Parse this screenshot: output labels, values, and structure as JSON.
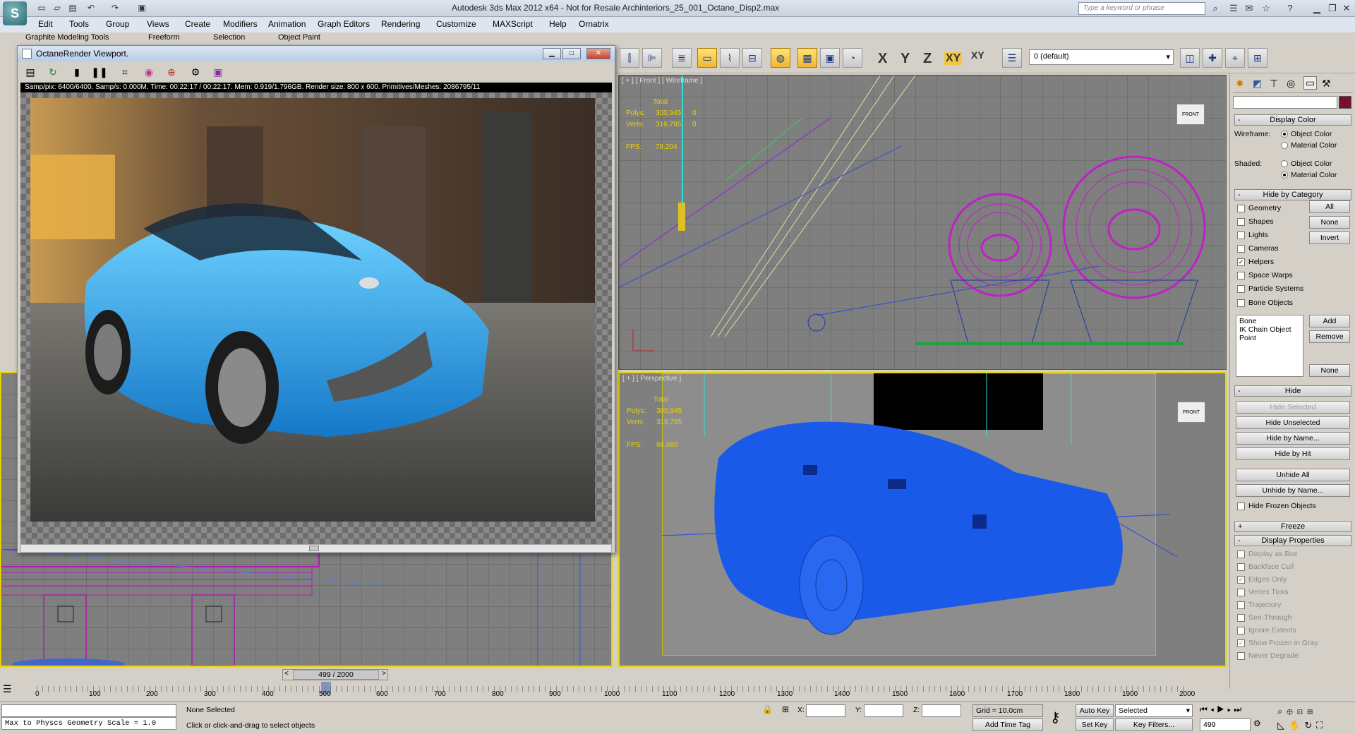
{
  "app": {
    "title": "Autodesk 3ds Max  2012 x64   - Not for Resale   Archinteriors_25_001_Octane_Disp2.max",
    "search_placeholder": "Type a keyword or phrase"
  },
  "menubar": [
    "Edit",
    "Tools",
    "Group",
    "Views",
    "Create",
    "Modifiers",
    "Animation",
    "Graph Editors",
    "Rendering",
    "Customize",
    "MAXScript",
    "Help",
    "Ornatrix"
  ],
  "ribbon_tabs": [
    "Graphite Modeling Tools",
    "Freeform",
    "Selection",
    "Object Paint"
  ],
  "toolbar": {
    "axes": [
      "X",
      "Y",
      "Z",
      "XY",
      "XY"
    ],
    "layer_value": "0 (default)"
  },
  "octane": {
    "title": "OctaneRender Viewport.",
    "stats": "Samp/pix: 6400/6400.  Samp/s: 0.000M.  Time: 00:22:17 / 00:22:17.  Mem: 0.919/1.796GB.  Render size: 800 x 600.  Primitives/Meshes: 2086795/11"
  },
  "viewports": {
    "front": {
      "label": "[ + ] [ Front ] [ Wireframe ]",
      "total": "Total",
      "polys_label": "Polys:",
      "polys": "300,945",
      "polys_sel": "0",
      "verts_label": "Verts:",
      "verts": "316,795",
      "verts_sel": "0",
      "fps_label": "FPS:",
      "fps": "78.204",
      "viewcube": "FRONT"
    },
    "persp": {
      "label": "[ + ] [ Perspective ]",
      "total": "Total",
      "polys_label": "Polys:",
      "polys": "300,945",
      "verts_label": "Verts:",
      "verts": "316,795",
      "fps_label": "FPS:",
      "fps": "66.660",
      "viewcube": "FRONT"
    }
  },
  "command_panel": {
    "display_color": {
      "header": "Display Color",
      "wireframe_label": "Wireframe:",
      "shaded_label": "Shaded:",
      "object_color": "Object Color",
      "material_color": "Material Color"
    },
    "hide_by_category": {
      "header": "Hide by Category",
      "items": [
        {
          "label": "Geometry",
          "checked": false
        },
        {
          "label": "Shapes",
          "checked": false
        },
        {
          "label": "Lights",
          "checked": false
        },
        {
          "label": "Cameras",
          "checked": false
        },
        {
          "label": "Helpers",
          "checked": true
        },
        {
          "label": "Space Warps",
          "checked": false
        },
        {
          "label": "Particle Systems",
          "checked": false
        },
        {
          "label": "Bone Objects",
          "checked": false
        }
      ],
      "btn_all": "All",
      "btn_none": "None",
      "btn_invert": "Invert",
      "list": [
        "Bone",
        "IK Chain Object",
        "Point"
      ],
      "btn_add": "Add",
      "btn_remove": "Remove",
      "btn_none2": "None"
    },
    "hide": {
      "header": "Hide",
      "buttons": [
        "Hide Selected",
        "Hide Unselected",
        "Hide by Name...",
        "Hide by Hit",
        "Unhide All",
        "Unhide by Name..."
      ],
      "frozen": "Hide Frozen Objects"
    },
    "freeze_header": "Freeze",
    "display_properties": {
      "header": "Display Properties",
      "items": [
        {
          "label": "Display as Box",
          "checked": false
        },
        {
          "label": "Backface Cull",
          "checked": false
        },
        {
          "label": "Edges Only",
          "checked": true
        },
        {
          "label": "Vertex Ticks",
          "checked": false
        },
        {
          "label": "Trajectory",
          "checked": false
        },
        {
          "label": "See-Through",
          "checked": false
        },
        {
          "label": "Ignore Extents",
          "checked": false
        },
        {
          "label": "Show Frozen in Gray",
          "checked": true
        },
        {
          "label": "Never Degrade",
          "checked": false
        }
      ]
    }
  },
  "timeline": {
    "frame": "499 / 2000",
    "ticks": [
      "0",
      "100",
      "200",
      "300",
      "400",
      "500",
      "600",
      "700",
      "800",
      "900",
      "1000",
      "1100",
      "1200",
      "1300",
      "1400",
      "1500",
      "1600",
      "1700",
      "1800",
      "1900",
      "2000"
    ]
  },
  "statusbar": {
    "maxscript": "Max to Physcs Geometry Scale = 1.0",
    "selection": "None Selected",
    "prompt": "Click or click-and-drag to select objects",
    "x_label": "X:",
    "y_label": "Y:",
    "z_label": "Z:",
    "grid": "Grid = 10.0cm",
    "add_time_tag": "Add Time Tag",
    "auto_key": "Auto Key",
    "set_key": "Set Key",
    "key_mode": "Selected",
    "key_filters": "Key Filters...",
    "frame_field": "499"
  }
}
